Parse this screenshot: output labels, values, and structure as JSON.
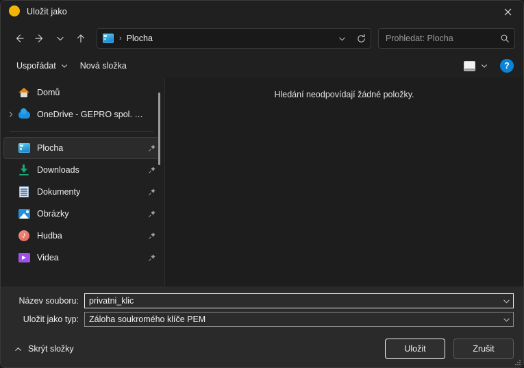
{
  "window": {
    "title": "Uložit jako",
    "app_icon": "app-circle-icon",
    "close_label": "×",
    "accent_color": "#f2b705"
  },
  "navbar": {
    "back_tooltip": "Zpět",
    "forward_tooltip": "Vpřed",
    "recent_tooltip": "Poslední umístění",
    "up_tooltip": "Nahoru",
    "breadcrumb": {
      "icon": "desktop-icon",
      "separator": "›",
      "path": "Plocha"
    },
    "refresh_tooltip": "Aktualizovat",
    "search": {
      "value": "",
      "placeholder": "Prohledat: Plocha",
      "icon": "search-icon"
    }
  },
  "commandbar": {
    "organize_label": "Uspořádat",
    "new_folder_label": "Nová složka",
    "view_icon": "view-mode-icon",
    "help_label": "?"
  },
  "sidebar": {
    "groups": [
      {
        "items": [
          {
            "label": "Domů",
            "icon": "home-icon",
            "expander": false,
            "pinned": false,
            "selected": false
          },
          {
            "label": "OneDrive - GEPRO spol. s r.o",
            "icon": "cloud-icon",
            "expander": true,
            "pinned": false,
            "selected": false
          }
        ]
      },
      {
        "items": [
          {
            "label": "Plocha",
            "icon": "desktop-icon",
            "expander": false,
            "pinned": true,
            "selected": true
          },
          {
            "label": "Downloads",
            "icon": "download-icon",
            "expander": false,
            "pinned": true,
            "selected": false
          },
          {
            "label": "Dokumenty",
            "icon": "document-icon",
            "expander": false,
            "pinned": true,
            "selected": false
          },
          {
            "label": "Obrázky",
            "icon": "pictures-icon",
            "expander": false,
            "pinned": true,
            "selected": false
          },
          {
            "label": "Hudba",
            "icon": "music-icon",
            "expander": false,
            "pinned": true,
            "selected": false
          },
          {
            "label": "Videa",
            "icon": "video-icon",
            "expander": false,
            "pinned": true,
            "selected": false
          }
        ]
      }
    ]
  },
  "content": {
    "empty_message": "Hledání neodpovídají žádné položky."
  },
  "form": {
    "filename_label": "Název souboru:",
    "filename_value": "privatni_klic",
    "filetype_label": "Uložit jako typ:",
    "filetype_value": "Záloha soukromého klíče PEM"
  },
  "footer": {
    "hide_folders_label": "Skrýt složky",
    "save_label": "Uložit",
    "cancel_label": "Zrušit"
  }
}
